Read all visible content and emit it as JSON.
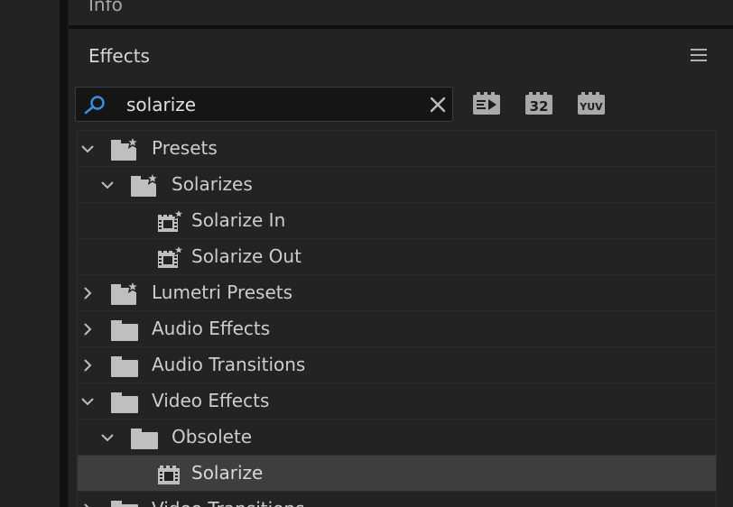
{
  "info_panel": {
    "title": "Info"
  },
  "effects_panel": {
    "title": "Effects",
    "search": {
      "value": "solarize",
      "placeholder": ""
    },
    "filters": [
      {
        "name": "accelerated-effects",
        "label": ""
      },
      {
        "name": "32-bit",
        "label": "32"
      },
      {
        "name": "yuv",
        "label": "YUV"
      }
    ],
    "tree": [
      {
        "label": "Presets",
        "type": "preset-folder",
        "level": 0,
        "expanded": true
      },
      {
        "label": "Solarizes",
        "type": "preset-folder",
        "level": 1,
        "expanded": true
      },
      {
        "label": "Solarize In",
        "type": "preset",
        "level": 2
      },
      {
        "label": "Solarize Out",
        "type": "preset",
        "level": 2
      },
      {
        "label": "Lumetri Presets",
        "type": "preset-folder",
        "level": 0,
        "expanded": false
      },
      {
        "label": "Audio Effects",
        "type": "folder",
        "level": 0,
        "expanded": false
      },
      {
        "label": "Audio Transitions",
        "type": "folder",
        "level": 0,
        "expanded": false
      },
      {
        "label": "Video Effects",
        "type": "folder",
        "level": 0,
        "expanded": true
      },
      {
        "label": "Obsolete",
        "type": "folder",
        "level": 1,
        "expanded": true
      },
      {
        "label": "Solarize",
        "type": "effect",
        "level": 2,
        "selected": true
      },
      {
        "label": "Video Transitions",
        "type": "folder",
        "level": 0,
        "expanded": false
      }
    ]
  },
  "colors": {
    "panel": "#232323",
    "selected_row": "#3e3e3e",
    "search_icon": "#3b8ee3",
    "text": "#cdcdcd"
  }
}
